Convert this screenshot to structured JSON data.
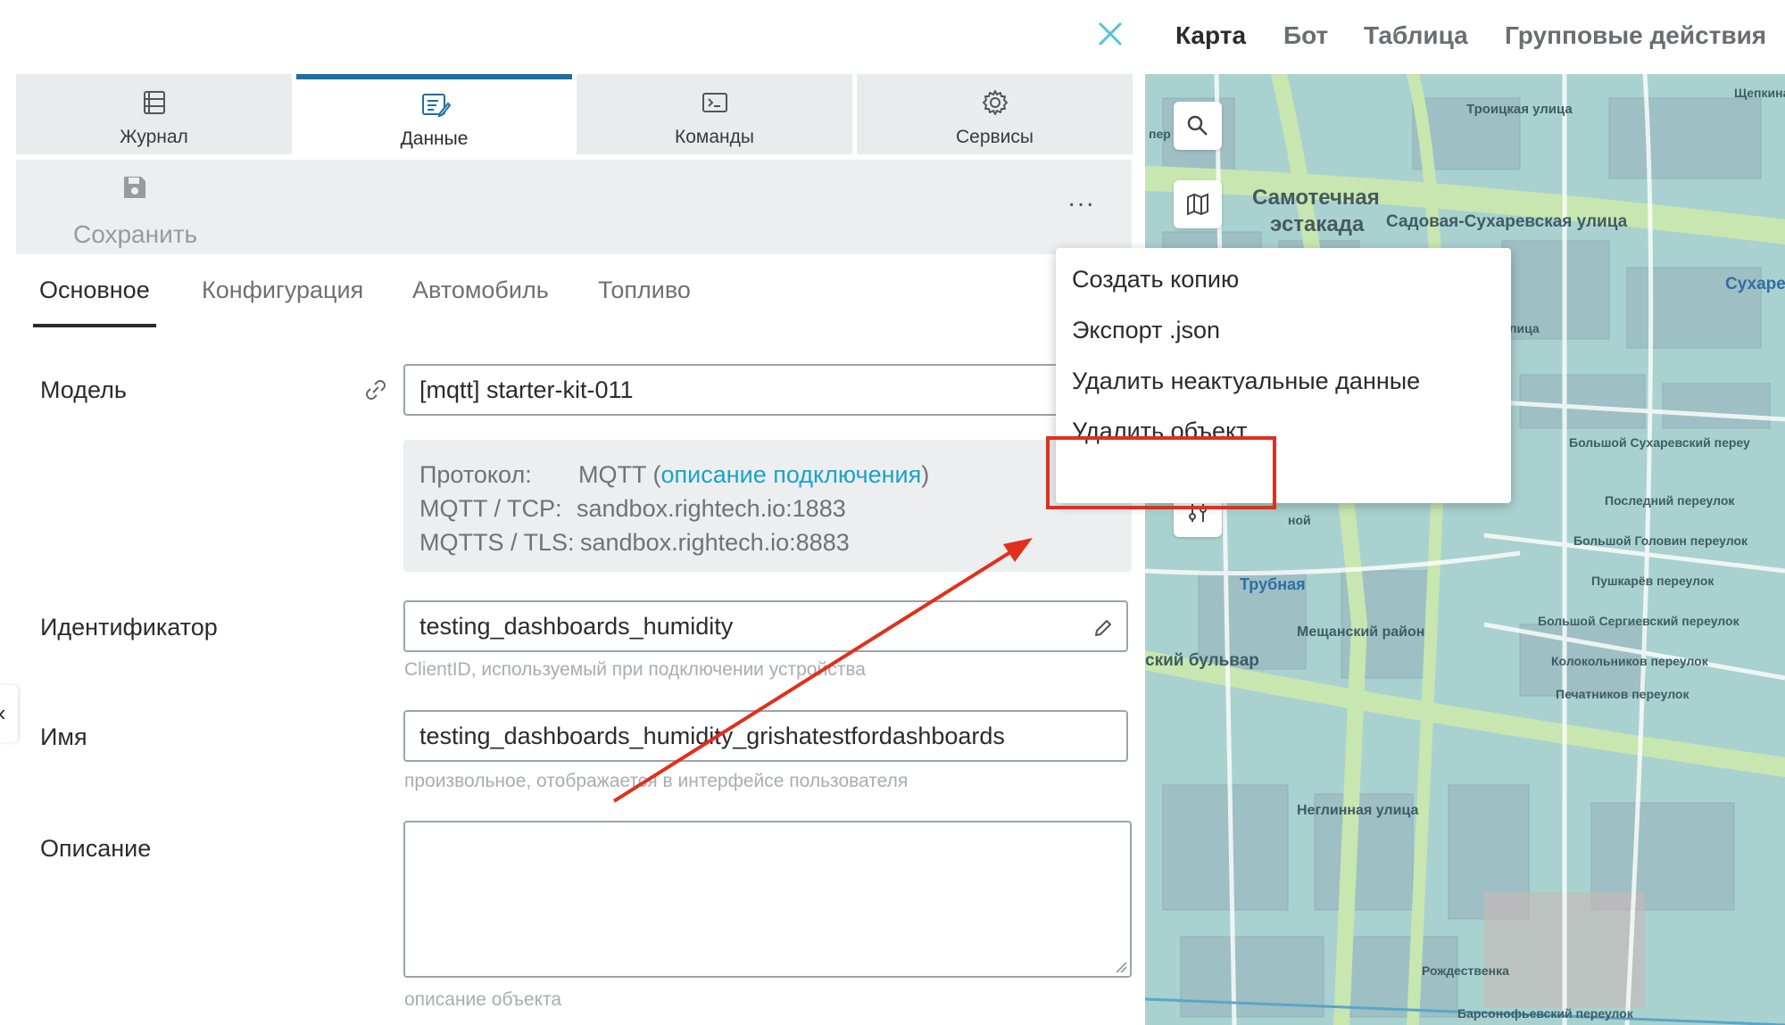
{
  "panel": {
    "tabs": [
      {
        "label": "Журнал",
        "icon": "journal-icon"
      },
      {
        "label": "Данные",
        "icon": "data-icon"
      },
      {
        "label": "Команды",
        "icon": "commands-icon"
      },
      {
        "label": "Сервисы",
        "icon": "services-icon"
      }
    ],
    "active_tab": "Данные",
    "toolbar": {
      "save_label": "Сохранить",
      "more_label": "..."
    },
    "subtabs": [
      "Основное",
      "Конфигурация",
      "Автомобиль",
      "Топливо"
    ],
    "active_subtab": "Основное",
    "model": {
      "label": "Модель",
      "value": "[mqtt] starter-kit-011"
    },
    "protocol": {
      "protocol_label": "Протокол:",
      "protocol_value": "MQTT (",
      "protocol_link": "описание подключения",
      "protocol_close": ")",
      "tcp_label": "MQTT / TCP:",
      "tcp_value": "sandbox.rightech.io:1883",
      "tls_label": "MQTTS / TLS:",
      "tls_value": "sandbox.rightech.io:8883"
    },
    "identifier": {
      "label": "Идентификатор",
      "value": "testing_dashboards_humidity",
      "hint": "ClientID, используемый при подключении устройства"
    },
    "name": {
      "label": "Имя",
      "value": "testing_dashboards_humidity_grishatestfordashboards",
      "hint": "произвольное, отображается в интерфейсе пользователя"
    },
    "description": {
      "label": "Описание",
      "value": "",
      "hint": "описание объекта"
    }
  },
  "map": {
    "tabs": [
      "Карта",
      "Бот",
      "Таблица",
      "Групповые действия"
    ],
    "active_tab": "Карта",
    "streets": [
      "Троицкая улица",
      "Самотечная",
      "эстакада",
      "Садовая-Сухаревская улица",
      "Сухаре",
      "Большой Сухаревский переу",
      "Последний переулок",
      "Большой Головин переулок",
      "Пушкарёв переулок",
      "Большой Сергиевский переулок",
      "Колокольников переулок",
      "Печатников переулок",
      "Трубная",
      "ский бульвар",
      "Мещанский район",
      "Неглинная улица",
      "Рождественка",
      "Барсонофьевский переулок",
      "пер",
      "Щепкина",
      "улица",
      "ной"
    ]
  },
  "menu": {
    "items": [
      "Создать копию",
      "Экспорт .json",
      "Удалить неактуальные данные",
      "Удалить объект"
    ],
    "highlighted": "Удалить объект"
  },
  "colors": {
    "accent": "#1b6fa5",
    "link": "#1aa3c8",
    "close": "#4ec6d6",
    "annotation": "#e0301e",
    "map_bg": "#a9d1d0"
  }
}
